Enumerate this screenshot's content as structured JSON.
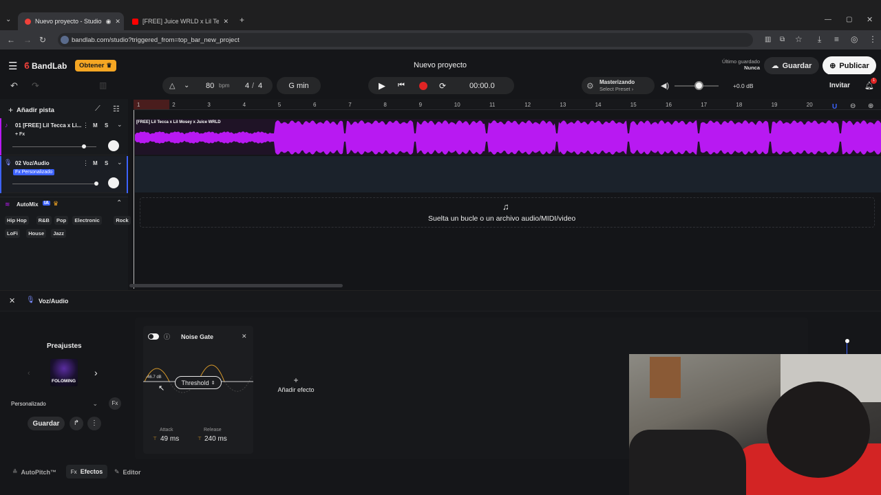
{
  "browser": {
    "tabs": [
      {
        "title": "Nuevo proyecto - Studio",
        "active": true
      },
      {
        "title": "[FREE] Juice WRLD x Lil Tecca Ty",
        "active": false
      }
    ],
    "url": "bandlab.com/studio?triggered_from=top_bar_new_project"
  },
  "app": {
    "brand": "BandLab",
    "get_button": "Obtener",
    "project_title": "Nuevo proyecto",
    "last_saved_label": "Último guardado",
    "last_saved_value": "Nunca",
    "save_button": "Guardar",
    "publish_button": "Publicar",
    "invite_button": "Invitar",
    "notification_count": "1"
  },
  "transport": {
    "tempo": "80",
    "tempo_unit": "bpm",
    "time_sig_num": "4",
    "time_sig_sep": "/",
    "time_sig_den": "4",
    "key": "G min",
    "time": "00:00.0",
    "mastering_title": "Masterizando",
    "mastering_sub": "Select Preset ›",
    "volume_db": "+0.0 dB",
    "master_volume": 0.55
  },
  "tracks_panel": {
    "add_track": "Añadir pista",
    "tracks": [
      {
        "name": "01  [FREE] Lil Tecca x Li...",
        "fx": "+ Fx",
        "m": "M",
        "s": "S",
        "volume": 0.85
      },
      {
        "name": "02  Voz/Audio",
        "fx": "Fx Personalizado",
        "m": "M",
        "s": "S",
        "volume": 1.0
      }
    ],
    "automix_label": "AutoMix",
    "automix_badge": "IA",
    "genres_row1": [
      "Hip Hop",
      "R&B",
      "Pop",
      "Electronic",
      "Rock"
    ],
    "genres_row2": [
      "LoFi",
      "House",
      "Jazz"
    ]
  },
  "timeline": {
    "ruler": [
      "1",
      "2",
      "3",
      "4",
      "5",
      "6",
      "7",
      "8",
      "9",
      "10",
      "11",
      "12",
      "13",
      "14",
      "15",
      "16",
      "17",
      "18",
      "19",
      "20"
    ],
    "clip_title": "[FREE] Lil Tecca x Lil Mosey x Juice WRLD",
    "drop_hint": "Suelta un bucle o un archivo audio/MIDI/video"
  },
  "editor": {
    "track_label": "Voz/Audio",
    "presets_title": "Preajustes",
    "preset_art_text": "FOLOMING",
    "preset_select": "Personalizado",
    "save_button": "Guardar",
    "effect_name": "Noise Gate",
    "threshold_value": "-46.7 dB",
    "threshold_button": "Threshold",
    "attack_label": "Attack",
    "attack_value": "49 ms",
    "release_label": "Release",
    "release_value": "240 ms",
    "add_effect": "Añadir efecto"
  },
  "bottom_tabs": [
    {
      "label": "AutoPitch™"
    },
    {
      "label": "Efectos",
      "prefix": "Fx"
    },
    {
      "label": "Editor"
    }
  ],
  "colors": {
    "accent_orange": "#f5a623",
    "brand_red": "#f0413a",
    "waveform_purple": "#b819f2",
    "record_red": "#e02424",
    "track_selected_blue": "#3d63ff"
  }
}
